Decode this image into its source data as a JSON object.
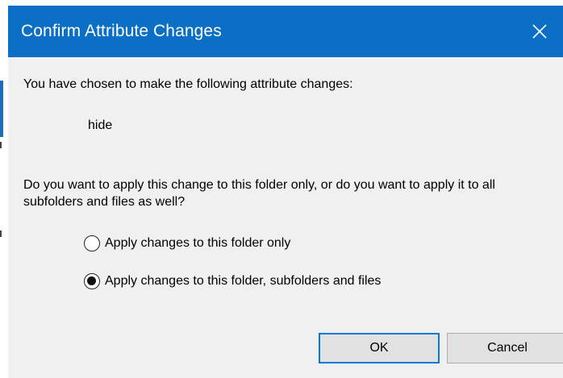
{
  "window": {
    "title": "Confirm Attribute Changes",
    "close_icon": "close-icon"
  },
  "body": {
    "intro": "You have chosen to make the following attribute changes:",
    "change": "hide",
    "question": "Do you want to apply this change to this folder only, or do you want to apply it to all subfolders and files as well?"
  },
  "options": [
    {
      "label": "Apply changes to this folder only",
      "checked": false
    },
    {
      "label": "Apply changes to this folder, subfolders and files",
      "checked": true
    }
  ],
  "buttons": {
    "ok": "OK",
    "cancel": "Cancel"
  },
  "colors": {
    "titlebar": "#0b70c5",
    "dialog_bg": "#f0f0f0",
    "focus_border": "#0a78d7"
  }
}
